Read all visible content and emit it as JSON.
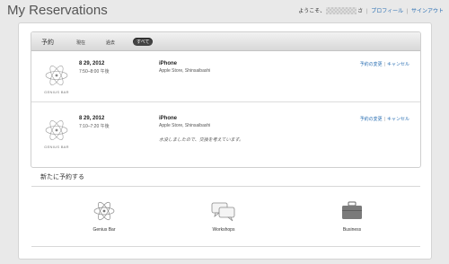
{
  "page": {
    "title": "My Reservations"
  },
  "topnav": {
    "greeting": "ようこそ、",
    "greeting_suffix": "さ",
    "profile_link": "プロフィール",
    "signout_link": "サインアウト"
  },
  "reservations": {
    "heading": "予約",
    "filters": [
      {
        "label": "現在"
      },
      {
        "label": "過去"
      },
      {
        "label": "すべて",
        "active": true
      }
    ],
    "rows": [
      {
        "logo_text": "GENIUS BAR",
        "date": "8 29, 2012",
        "time": "7:50–8:00 午後",
        "product": "iPhone",
        "store": "Apple Store, Shinsaibashi",
        "note": "",
        "change_link": "予約の変更",
        "cancel_link": "キャンセル"
      },
      {
        "logo_text": "GENIUS BAR",
        "date": "8 29, 2012",
        "time": "7:10–7:20 午後",
        "product": "iPhone",
        "store": "Apple Store, Shinsaibashi",
        "note": "水没しましたので、交換を考えています。",
        "change_link": "予約の変更",
        "cancel_link": "キャンセル"
      }
    ]
  },
  "new_reservation": {
    "heading": "新たに予約する",
    "options": [
      {
        "label": "Genius Bar",
        "icon": "genius-bar-icon"
      },
      {
        "label": "Workshops",
        "icon": "speech-bubbles-icon"
      },
      {
        "label": "Business",
        "icon": "briefcase-icon"
      }
    ]
  }
}
